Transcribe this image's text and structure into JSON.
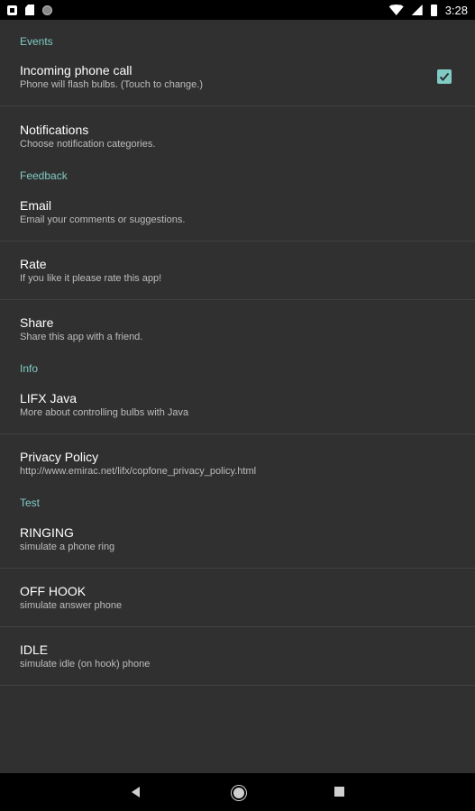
{
  "status_bar": {
    "time": "3:28",
    "left_icons": [
      "notification-icon",
      "sd-card-icon",
      "sync-icon"
    ],
    "right_icons": [
      "wifi-icon",
      "signal-icon",
      "battery-icon"
    ]
  },
  "accent_color": "#80cbc4",
  "sections": [
    {
      "title": "Events",
      "items": [
        {
          "title": "Incoming phone call",
          "summary": "Phone will flash bulbs. (Touch to change.)",
          "checked": true
        },
        {
          "title": "Notifications",
          "summary": "Choose notification categories."
        }
      ]
    },
    {
      "title": "Feedback",
      "items": [
        {
          "title": "Email",
          "summary": "Email your comments or suggestions."
        },
        {
          "title": "Rate",
          "summary": "If you like it please rate this app!"
        },
        {
          "title": "Share",
          "summary": "Share this app with a friend."
        }
      ]
    },
    {
      "title": "Info",
      "items": [
        {
          "title": "LIFX Java",
          "summary": "More about controlling bulbs with Java"
        },
        {
          "title": "Privacy Policy",
          "summary": "http://www.emirac.net/lifx/copfone_privacy_policy.html"
        }
      ]
    },
    {
      "title": "Test",
      "items": [
        {
          "title": "RINGING",
          "summary": "simulate a phone ring"
        },
        {
          "title": "OFF HOOK",
          "summary": "simulate answer phone"
        },
        {
          "title": "IDLE",
          "summary": "simulate idle (on hook) phone"
        }
      ]
    }
  ],
  "nav_bar": {
    "icons": [
      "back-icon",
      "home-icon",
      "recents-icon"
    ]
  }
}
